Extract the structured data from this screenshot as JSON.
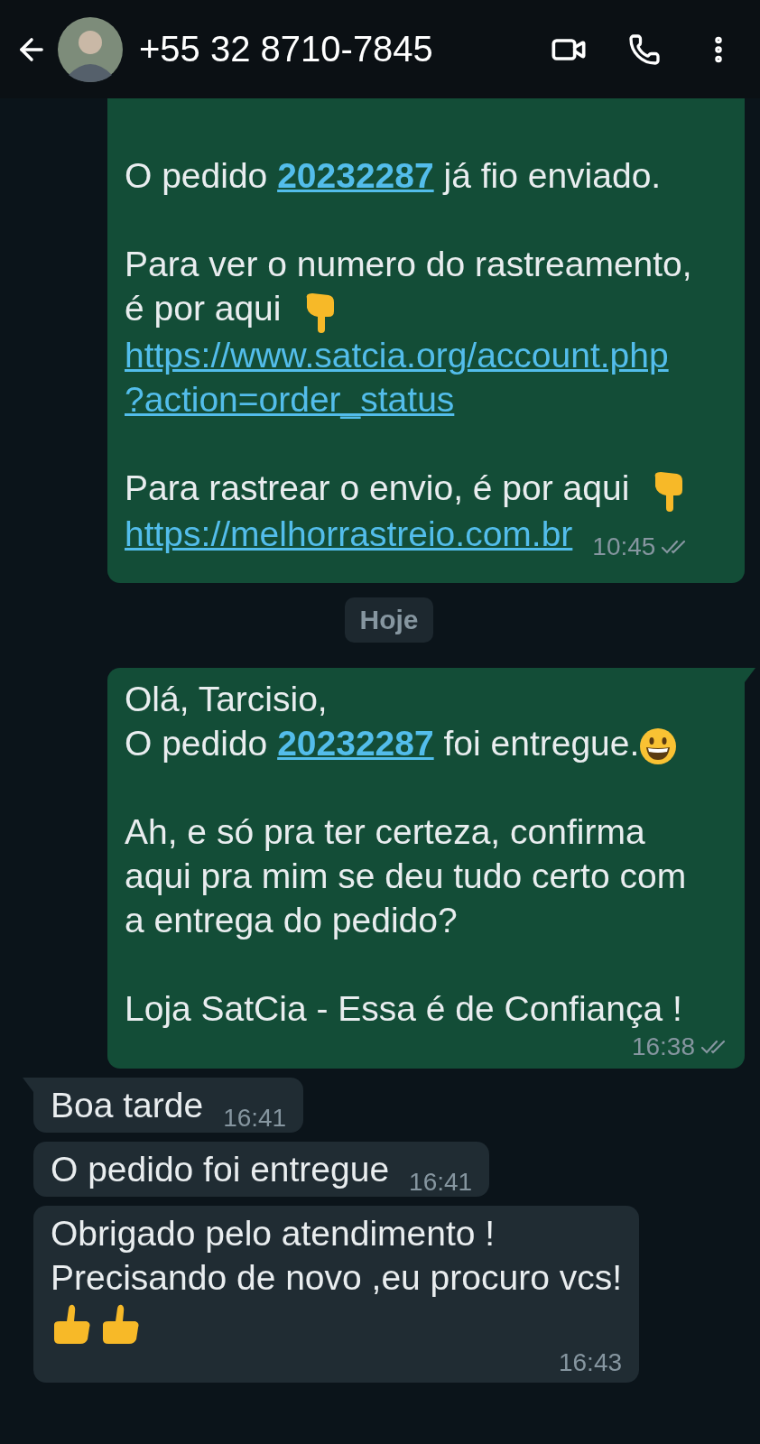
{
  "header": {
    "title": "+55 32 8710-7845"
  },
  "messages": [
    {
      "kind": "outgoing",
      "tail": false,
      "time_inline": true,
      "time": "10:45",
      "read": false,
      "paragraphs": [
        {
          "lines": [
            {
              "parts": [
                {
                  "kind": "text",
                  "text": "O pedido "
                },
                {
                  "kind": "link",
                  "text": "20232287",
                  "bold": true
                },
                {
                  "kind": "text",
                  "text": " já fio enviado."
                }
              ]
            }
          ]
        },
        {
          "lines": [
            {
              "parts": [
                {
                  "kind": "text",
                  "text": "Para ver o numero do rastreamento,"
                }
              ]
            },
            {
              "parts": [
                {
                  "kind": "text",
                  "text": "é por aqui "
                },
                {
                  "kind": "hand-down"
                }
              ]
            },
            {
              "parts": [
                {
                  "kind": "link",
                  "text": "https://www.satcia.org/account.php",
                  "bold": false
                }
              ]
            },
            {
              "parts": [
                {
                  "kind": "link",
                  "text": "?action=order_status",
                  "bold": false
                }
              ]
            }
          ]
        },
        {
          "lines": [
            {
              "parts": [
                {
                  "kind": "text",
                  "text": "Para rastrear o envio, é por aqui "
                },
                {
                  "kind": "hand-down"
                }
              ]
            },
            {
              "parts": [
                {
                  "kind": "link",
                  "text": "https://melhorrastreio.com.br",
                  "bold": false
                }
              ]
            }
          ]
        }
      ]
    },
    {
      "kind": "date",
      "label": "Hoje"
    },
    {
      "kind": "outgoing",
      "tail": true,
      "time_inline": false,
      "time": "16:38",
      "read": false,
      "paragraphs": [
        {
          "lines": [
            {
              "parts": [
                {
                  "kind": "text",
                  "text": "Olá, Tarcisio,"
                }
              ]
            },
            {
              "parts": [
                {
                  "kind": "text",
                  "text": "O pedido "
                },
                {
                  "kind": "link",
                  "text": "20232287",
                  "bold": true
                },
                {
                  "kind": "text",
                  "text": " foi entregue."
                },
                {
                  "kind": "smiley"
                }
              ]
            }
          ]
        },
        {
          "lines": [
            {
              "parts": [
                {
                  "kind": "text",
                  "text": "Ah, e só pra ter certeza, confirma"
                }
              ]
            },
            {
              "parts": [
                {
                  "kind": "text",
                  "text": "aqui pra mim se deu tudo certo com"
                }
              ]
            },
            {
              "parts": [
                {
                  "kind": "text",
                  "text": "a entrega do pedido?"
                }
              ]
            }
          ]
        },
        {
          "lines": [
            {
              "parts": [
                {
                  "kind": "text",
                  "text": "Loja SatCia - Essa é de Confiança !"
                }
              ]
            }
          ]
        }
      ]
    },
    {
      "kind": "incoming",
      "tail": true,
      "time_inline": true,
      "time": "16:41",
      "paragraphs": [
        {
          "lines": [
            {
              "parts": [
                {
                  "kind": "text",
                  "text": "Boa tarde"
                }
              ]
            }
          ]
        }
      ]
    },
    {
      "kind": "incoming",
      "tail": false,
      "time_inline": true,
      "time": "16:41",
      "paragraphs": [
        {
          "lines": [
            {
              "parts": [
                {
                  "kind": "text",
                  "text": "O pedido foi entregue"
                }
              ]
            }
          ]
        }
      ]
    },
    {
      "kind": "incoming",
      "tail": false,
      "time_inline": false,
      "time": "16:43",
      "paragraphs": [
        {
          "lines": [
            {
              "parts": [
                {
                  "kind": "text",
                  "text": "Obrigado pelo atendimento !"
                }
              ]
            },
            {
              "parts": [
                {
                  "kind": "text",
                  "text": "Precisando de novo ,eu procuro vcs!"
                }
              ]
            },
            {
              "parts": [
                {
                  "kind": "thumbs-up"
                },
                {
                  "kind": "thumbs-up"
                }
              ]
            }
          ]
        }
      ]
    }
  ]
}
